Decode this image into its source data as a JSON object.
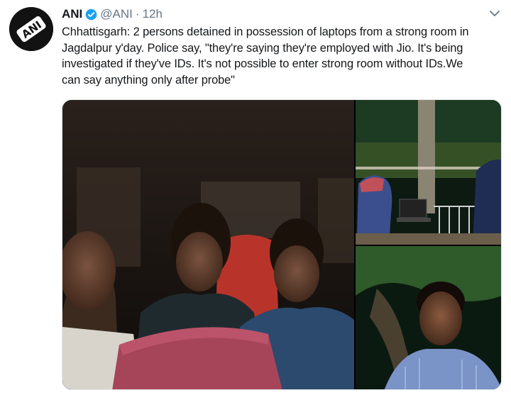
{
  "tweet": {
    "author_name": "ANI",
    "handle": "@ANI",
    "separator": "·",
    "time": "12h",
    "avatar_text": "ANI",
    "text_lines": [
      "Chhattisgarh: 2 persons detained in possession of laptops from a strong room in",
      "Jagdalpur y'day. Police say, \"they're saying they're employed with Jio. It's being",
      "investigated if they've IDs. It's not possible to enter strong room without IDs.We",
      "can say anything only after probe\""
    ]
  },
  "icons": {
    "verified": "verified-badge-icon",
    "menu": "chevron-down-icon"
  },
  "colors": {
    "verified_blue": "#1da1f2",
    "secondary_text": "#657786",
    "primary_text": "#14171a"
  },
  "media": {
    "photo_count": 3
  }
}
